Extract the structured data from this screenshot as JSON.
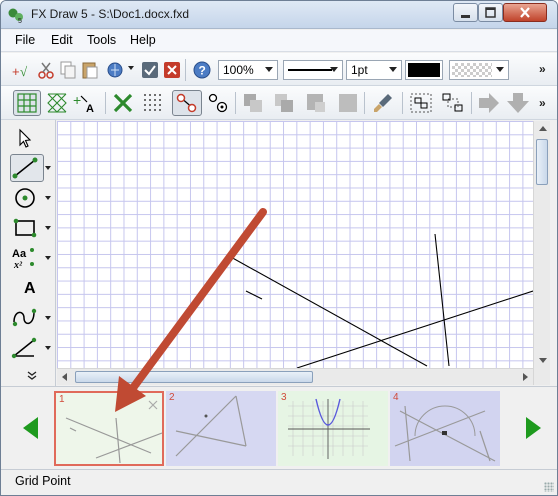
{
  "window": {
    "title": "FX Draw 5 - S:\\Doc1.docx.fxd",
    "app_icon": "fx-draw-logo-icon",
    "controls": [
      "minimize-icon",
      "maximize-icon",
      "close-icon"
    ]
  },
  "menu": {
    "items": [
      "File",
      "Edit",
      "Tools",
      "Help"
    ]
  },
  "toolbar1": {
    "zoom": "100%",
    "line_width": "1pt",
    "line_color": "#000000",
    "more": "»"
  },
  "toolbar2": {
    "more": "»"
  },
  "palette": {
    "text_tool_label": "A"
  },
  "canvas": {
    "background": "#ffffff",
    "grid_color": "#c5c5ee"
  },
  "thumbnails": [
    {
      "number": "1",
      "selected": true
    },
    {
      "number": "2",
      "selected": false
    },
    {
      "number": "3",
      "selected": false
    },
    {
      "number": "4",
      "selected": false
    }
  ],
  "status": {
    "text": "Grid Point"
  },
  "colors": {
    "annotation_arrow": "#c04a33",
    "thumb_selected_border": "#e06a5a",
    "nav_arrow": "#1e9a1e",
    "thumb2_bg": "#d6d8f2",
    "thumb3_bg": "#e6f5e4",
    "thumb4_bg": "#d2d4f0"
  }
}
